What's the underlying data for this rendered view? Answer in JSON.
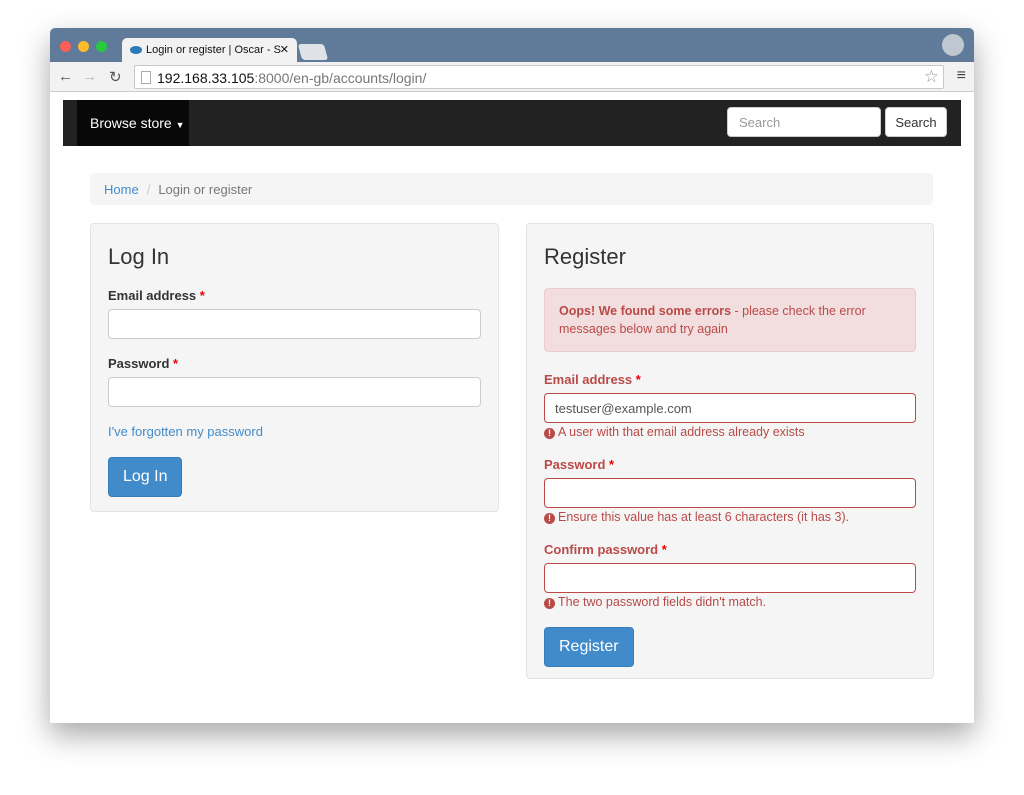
{
  "browser": {
    "tab_title": "Login or register | Oscar - S",
    "url_host": "192.168.33.105",
    "url_path": ":8000/en-gb/accounts/login/"
  },
  "navbar": {
    "browse": "Browse store",
    "search_placeholder": "Search",
    "search_button": "Search"
  },
  "breadcrumb": {
    "home": "Home",
    "sep": "/",
    "current": "Login or register"
  },
  "login": {
    "title": "Log In",
    "email_label": "Email address",
    "password_label": "Password",
    "required": "*",
    "forgot": "I've forgotten my password",
    "button": "Log In"
  },
  "register": {
    "title": "Register",
    "alert_bold": "Oops! We found some errors",
    "alert_rest": " - please check the error messages below and try again",
    "email_label": "Email address",
    "email_value": "testuser@example.com",
    "email_error": "A user with that email address already exists",
    "password_label": "Password",
    "password_error": "Ensure this value has at least 6 characters (it has 3).",
    "confirm_label": "Confirm password",
    "confirm_error": "The two password fields didn't match.",
    "required": "*",
    "button": "Register"
  },
  "colors": {
    "primary": "#428bca",
    "error": "#b94a48",
    "navbar": "#222222"
  }
}
